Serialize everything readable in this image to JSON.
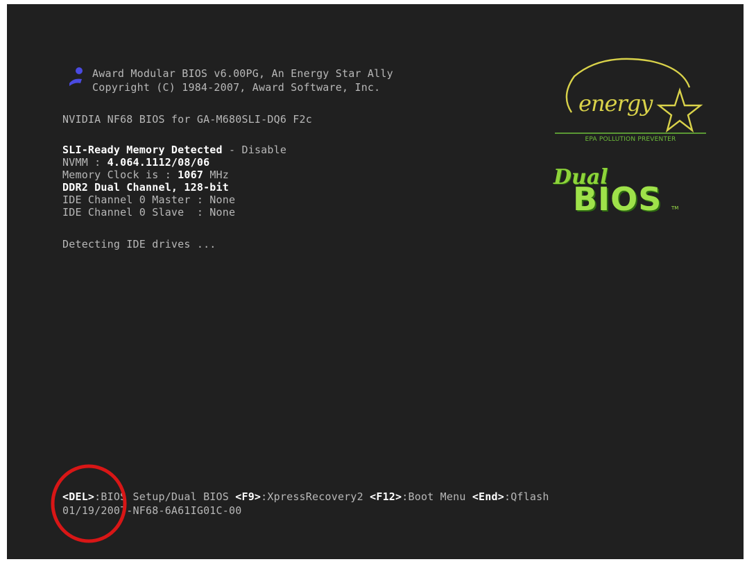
{
  "header": {
    "line1": "Award Modular BIOS v6.00PG, An Energy Star Ally",
    "line2": "Copyright (C) 1984-2007, Award Software, Inc."
  },
  "board_line": "NVIDIA NF68 BIOS for GA-M680SLI-DQ6 F2c",
  "sli": {
    "label": "SLI-Ready Memory Detected",
    "separator": " - ",
    "value": "Disable"
  },
  "nvmm": {
    "label": "NVMM : ",
    "value": "4.064.1112/08/06"
  },
  "memclock": {
    "label": "Memory Clock is : ",
    "value": "1067",
    "unit": " MHz"
  },
  "ddr": "DDR2 Dual Channel, 128-bit",
  "ide_master": "IDE Channel 0 Master : None",
  "ide_slave": "IDE Channel 0 Slave  : None",
  "detecting": "Detecting IDE drives ...",
  "energy_logo": {
    "word": "energy",
    "caption": "EPA POLLUTION PREVENTER"
  },
  "dualbios_logo": {
    "dual": "Dual",
    "bios": "BIOS",
    "tm": "TM"
  },
  "footer": {
    "del_key": "<DEL>",
    "del_text": ":BIOS Setup/Dual BIOS ",
    "f9_key": "<F9>",
    "f9_text": ":XpressRecovery2 ",
    "f12_key": "<F12>",
    "f12_text": ":Boot Menu ",
    "end_key": "<End>",
    "end_text": ":Qflash",
    "bios_id": "01/19/2007-NF68-6A61IG01C-00"
  },
  "colors": {
    "background": "#202020",
    "text": "#b8b8b8",
    "highlight": "#ffffff",
    "annotation_circle": "#d81616",
    "award_logo": "#4a4ae0",
    "energy_logo": "#d9d24a",
    "dualbios_logo": "#9fe24a"
  },
  "icons": {
    "award_logo": "award-bios-logo-icon",
    "energy_star": "energy-star-logo-icon",
    "dual_bios": "dual-bios-logo-icon"
  }
}
